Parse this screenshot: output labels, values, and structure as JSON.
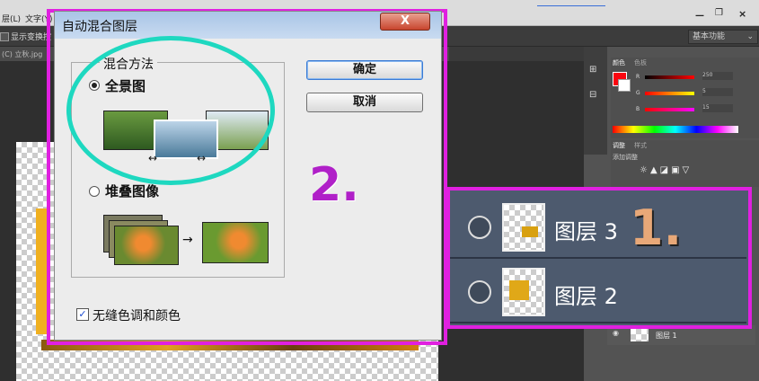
{
  "menubar": {
    "layer_menu": "层(L)",
    "type_menu": "文字(Y)"
  },
  "options": {
    "show_transform": "显示变换控",
    "workspace": "基本功能"
  },
  "document": {
    "tab_title": "(C) 立秋.jpg"
  },
  "dialog": {
    "title": "自动混合图层",
    "close_label": "X",
    "group_label": "混合方法",
    "panorama_label": "全景图",
    "stack_label": "堆叠图像",
    "ok_label": "确定",
    "cancel_label": "取消",
    "seamless_label": "无缝色调和颜色",
    "panorama_checked": true,
    "seamless_checked": true
  },
  "panels": {
    "color_tab": "颜色",
    "swatches_tab": "色板",
    "r_value": "250",
    "g_value": "5",
    "b_value": "15",
    "r_label": "R",
    "g_label": "G",
    "b_label": "B",
    "adjust_tab": "调整",
    "styles_tab": "样式",
    "add_adjust": "添加调整"
  },
  "layers": {
    "zoom_rows": [
      {
        "name": "图层 3"
      },
      {
        "name": "图层 2"
      }
    ],
    "small_row": "图层 1"
  },
  "annotations": {
    "step1": "1.",
    "step2": "2."
  },
  "colors": {
    "magenta": "#e020e0",
    "cyan": "#1ed8c0",
    "titlebar": "#b6cfee"
  }
}
